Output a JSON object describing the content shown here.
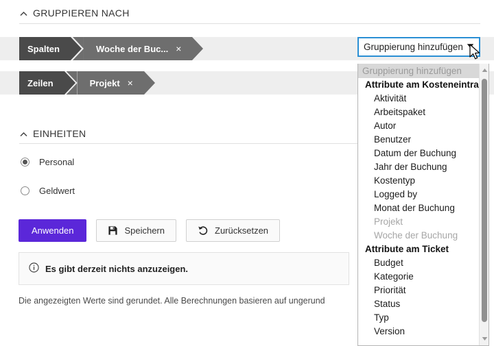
{
  "sections": {
    "group_by": {
      "title": "GRUPPIEREN NACH",
      "collapse_icon": "caret-up-icon"
    },
    "units": {
      "title": "EINHEITEN",
      "collapse_icon": "caret-up-icon"
    }
  },
  "group_by": {
    "rows": [
      {
        "axis": "Spalten",
        "field": "Woche der Buc...",
        "remove": "×"
      },
      {
        "axis": "Zeilen",
        "field": "Projekt",
        "remove": "×"
      }
    ]
  },
  "units": {
    "options": [
      {
        "label": "Personal",
        "checked": true
      },
      {
        "label": "Geldwert",
        "checked": false
      }
    ]
  },
  "buttons": {
    "apply": "Anwenden",
    "save": "Speichern",
    "reset": "Zurücksetzen",
    "save_icon": "floppy-disk-icon",
    "reset_icon": "undo-arrow-icon"
  },
  "info": {
    "icon": "info-circle-icon",
    "message": "Es gibt derzeit nichts anzuzeigen."
  },
  "footer_note": "Die angezeigten Werte sind gerundet. Alle Berechnungen basieren auf ungerund",
  "combobox": {
    "label": "Gruppierung hinzufügen",
    "caret_icon": "caret-down-icon",
    "focus_color": "#2a8fd4",
    "expanded": true
  },
  "dropdown": {
    "items": [
      {
        "label": "Gruppierung hinzufügen",
        "type": "placeholder"
      },
      {
        "label": "Attribute am Kosteneintrag",
        "type": "group"
      },
      {
        "label": "Aktivität",
        "type": "option"
      },
      {
        "label": "Arbeitspaket",
        "type": "option"
      },
      {
        "label": "Autor",
        "type": "option"
      },
      {
        "label": "Benutzer",
        "type": "option"
      },
      {
        "label": "Datum der Buchung",
        "type": "option"
      },
      {
        "label": "Jahr der Buchung",
        "type": "option"
      },
      {
        "label": "Kostentyp",
        "type": "option"
      },
      {
        "label": "Logged by",
        "type": "option"
      },
      {
        "label": "Monat der Buchung",
        "type": "option"
      },
      {
        "label": "Projekt",
        "type": "disabled"
      },
      {
        "label": "Woche der Buchung",
        "type": "disabled"
      },
      {
        "label": "Attribute am Ticket",
        "type": "group"
      },
      {
        "label": "Budget",
        "type": "option"
      },
      {
        "label": "Kategorie",
        "type": "option"
      },
      {
        "label": "Priorität",
        "type": "option"
      },
      {
        "label": "Status",
        "type": "option"
      },
      {
        "label": "Typ",
        "type": "option"
      },
      {
        "label": "Version",
        "type": "option"
      }
    ],
    "scrollbar": {
      "up_icon": "scroll-up-arrow-icon",
      "down_icon": "scroll-down-arrow-icon"
    }
  },
  "colors": {
    "chip_axis": "#4a4a4a",
    "chip_field": "#6e6e6e",
    "row_bg": "#eeeeee",
    "primary": "#5b27d9"
  },
  "cursor": {
    "icon": "mouse-pointer-icon"
  }
}
